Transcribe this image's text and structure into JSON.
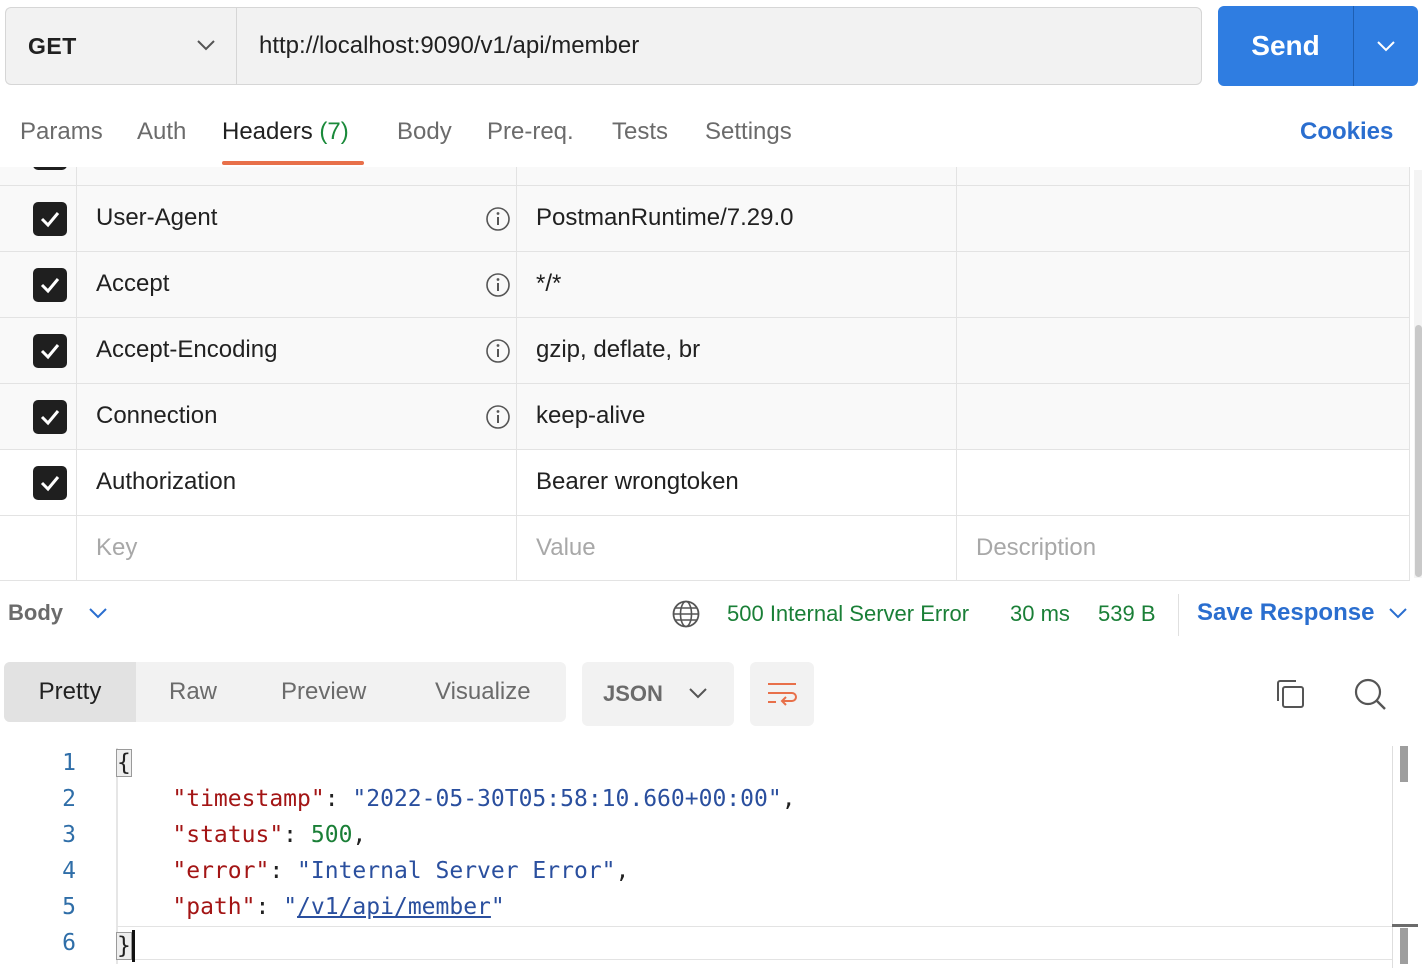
{
  "request": {
    "method": "GET",
    "url": "http://localhost:9090/v1/api/member",
    "send_label": "Send"
  },
  "tabs": [
    {
      "label": "Params"
    },
    {
      "label": "Auth"
    },
    {
      "label": "Headers",
      "count": "(7)",
      "active": true
    },
    {
      "label": "Body"
    },
    {
      "label": "Pre-req."
    },
    {
      "label": "Tests"
    },
    {
      "label": "Settings"
    }
  ],
  "cookies_label": "Cookies",
  "headers": [
    {
      "key": "User-Agent",
      "value": "PostmanRuntime/7.29.0",
      "checked": true,
      "info": true
    },
    {
      "key": "Accept",
      "value": "*/*",
      "checked": true,
      "info": true
    },
    {
      "key": "Accept-Encoding",
      "value": "gzip, deflate, br",
      "checked": true,
      "info": true
    },
    {
      "key": "Connection",
      "value": "keep-alive",
      "checked": true,
      "info": true
    },
    {
      "key": "Authorization",
      "value": "Bearer wrongtoken",
      "checked": true,
      "info": false
    }
  ],
  "new_row": {
    "key_placeholder": "Key",
    "value_placeholder": "Value",
    "description_placeholder": "Description"
  },
  "response": {
    "section_label": "Body",
    "status": "500 Internal Server Error",
    "time": "30 ms",
    "size": "539 B",
    "save_label": "Save Response",
    "view_modes": [
      "Pretty",
      "Raw",
      "Preview",
      "Visualize"
    ],
    "active_view": "Pretty",
    "language": "JSON"
  },
  "body_lines": {
    "numbers": [
      "1",
      "2",
      "3",
      "4",
      "5",
      "6"
    ],
    "open_brace": "{",
    "close_brace": "}",
    "timestamp_key": "\"timestamp\"",
    "timestamp_val": "\"2022-05-30T05:58:10.660+00:00\"",
    "status_key": "\"status\"",
    "status_val": "500",
    "error_key": "\"error\"",
    "error_val": "\"Internal Server Error\"",
    "path_key": "\"path\"",
    "path_val": "/v1/api/member",
    "quote": "\""
  },
  "colors": {
    "accent": "#2f7de1",
    "tab_indicator": "#e8704a",
    "status_error_text": "#1a7f37",
    "link": "#2a6ecf",
    "json_key": "#a31515",
    "json_string": "#2a4f9e",
    "json_number": "#1a7f37"
  },
  "icons": [
    "chevron-down-icon",
    "info-icon",
    "checkbox-checked-icon",
    "globe-icon",
    "wrap-lines-icon",
    "copy-icon",
    "search-icon"
  ]
}
